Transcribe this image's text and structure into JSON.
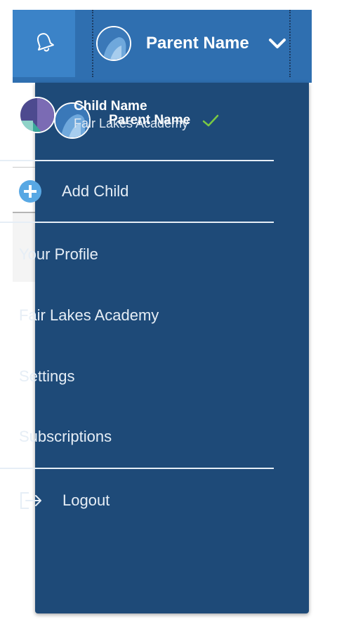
{
  "header": {
    "notification_icon": "bell-icon",
    "account_name": "Parent Name",
    "dropdown_icon": "chevron-down-icon"
  },
  "menu": {
    "profiles": [
      {
        "name": "Parent Name",
        "subtitle": "",
        "selected": true
      },
      {
        "name": "Child Name",
        "subtitle": "Fair Lakes Academy",
        "selected": false
      }
    ],
    "add_child_label": "Add Child",
    "items": [
      {
        "label": "Your Profile"
      },
      {
        "label": "Fair Lakes Academy"
      },
      {
        "label": "Settings"
      },
      {
        "label": "Subscriptions"
      }
    ],
    "logout_label": "Logout"
  },
  "colors": {
    "header_bar": "#2f6fb0",
    "menu_background": "#1e4a78",
    "check_green": "#7ac943",
    "add_icon": "#58a8e4"
  }
}
